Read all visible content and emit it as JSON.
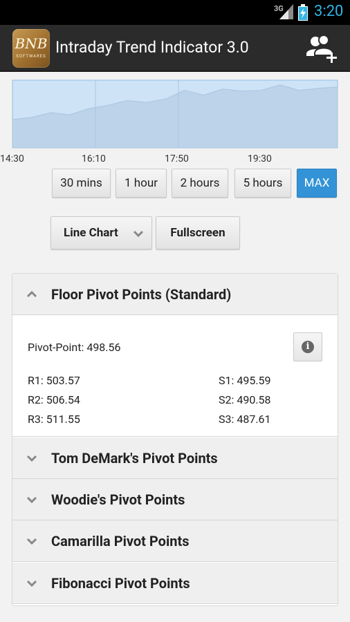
{
  "status_bar": {
    "network": "3G",
    "time": "3:20"
  },
  "action_bar": {
    "title": "Intraday Trend Indicator 3.0",
    "logo_text": "BNB",
    "logo_sub": "SOFTWARES"
  },
  "chart": {
    "x_ticks": [
      "14:30",
      "16:10",
      "17:50",
      "19:30"
    ],
    "colors": {
      "fill": "#bcd3ea",
      "selection": "#cfe3f6",
      "border": "#8ebde6"
    }
  },
  "chart_data": {
    "type": "area",
    "x": [
      "14:30",
      "16:10",
      "17:50",
      "19:30"
    ],
    "series": [
      {
        "values": [
          0.42,
          0.45,
          0.52,
          0.49,
          0.58,
          0.63,
          0.7,
          0.67,
          0.72,
          0.85,
          0.78,
          0.87,
          0.84,
          0.85,
          0.93,
          0.85,
          0.88,
          0.9
        ]
      }
    ],
    "note_values_are_relative_heights": "no y-axis shown"
  },
  "range_buttons": [
    {
      "label": "30 mins",
      "active": false
    },
    {
      "label": "1 hour",
      "active": false
    },
    {
      "label": "2 hours",
      "active": false
    },
    {
      "label": "5 hours",
      "active": false
    },
    {
      "label": "MAX",
      "active": true
    }
  ],
  "chart_type": {
    "select_label": "Line Chart",
    "fullscreen_label": "Fullscreen"
  },
  "sections": [
    {
      "title": "Floor Pivot Points (Standard)",
      "expanded": true
    },
    {
      "title": "Tom DeMark's Pivot Points",
      "expanded": false
    },
    {
      "title": "Woodie's Pivot Points",
      "expanded": false
    },
    {
      "title": "Camarilla Pivot Points",
      "expanded": false
    },
    {
      "title": "Fibonacci Pivot Points",
      "expanded": false
    }
  ],
  "floor_pivot": {
    "pivot_point": "Pivot-Point: 498.56",
    "resistance": [
      "R1: 503.57",
      "R2: 506.54",
      "R3: 511.55"
    ],
    "support": [
      "S1: 495.59",
      "S2: 490.58",
      "S3: 487.61"
    ]
  }
}
